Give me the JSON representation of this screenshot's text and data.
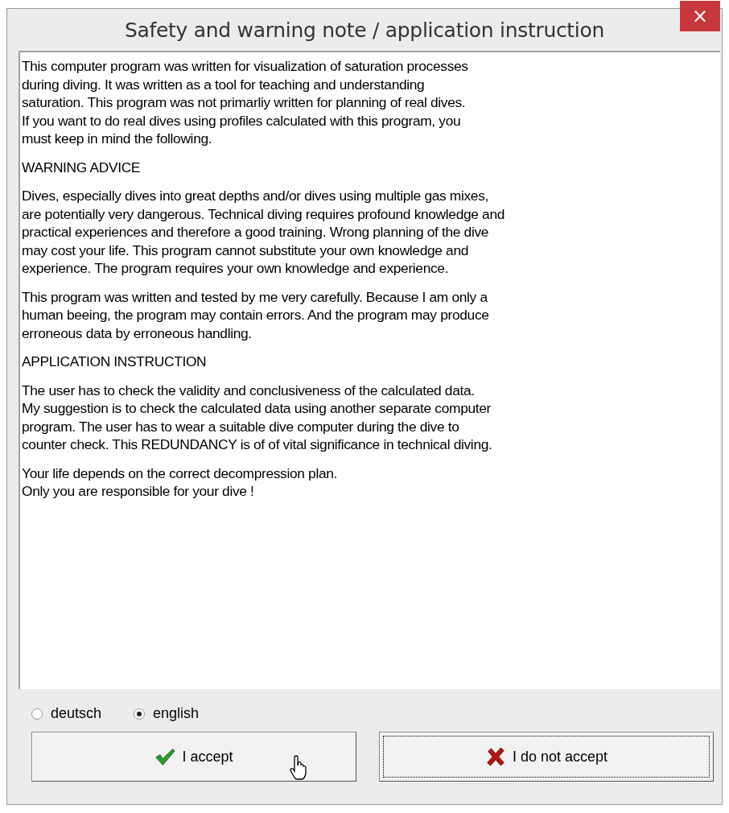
{
  "window": {
    "title": "Safety and warning note / application instruction",
    "close": "×"
  },
  "note": [
    {
      "lines": [
        "This computer program was written for visualization of saturation processes",
        "during diving. It was written as a tool for teaching and understanding",
        "saturation. This program was not primarliy written for planning of real dives.",
        "If you want to do real dives using profiles calculated with this program, you",
        "must keep in mind the following."
      ]
    },
    {
      "lines": [
        "WARNING ADVICE"
      ]
    },
    {
      "lines": [
        "Dives, especially dives into great depths and/or dives using multiple gas mixes,",
        "are potentially very dangerous. Technical diving requires profound knowledge and",
        "practical experiences and therefore a good training. Wrong planning of the dive",
        "may cost your life. This program cannot substitute your own knowledge and",
        "experience. The program requires your own knowledge and experience."
      ]
    },
    {
      "lines": [
        "This program was written and tested by me very carefully. Because I am only a",
        "human beeing, the program may contain errors. And the program may produce",
        "erroneous data by erroneous handling."
      ]
    },
    {
      "lines": [
        "APPLICATION INSTRUCTION"
      ]
    },
    {
      "lines": [
        "The user has to check the validity and conclusiveness of the calculated data.",
        "My suggestion is to check the calculated data using another separate computer",
        "program. The user has to wear a suitable dive computer during the dive to",
        "counter check. This REDUNDANCY is of of vital significance in technical diving."
      ]
    },
    {
      "lines": [
        "Your life depends on the correct decompression plan.",
        "Only you are responsible for your dive !"
      ]
    }
  ],
  "languages": [
    {
      "label": "deutsch",
      "selected": false
    },
    {
      "label": "english",
      "selected": true
    }
  ],
  "buttons": [
    {
      "kind": "accept",
      "label": "I accept",
      "focused": false
    },
    {
      "kind": "reject",
      "label": "I do not accept",
      "focused": true
    }
  ]
}
